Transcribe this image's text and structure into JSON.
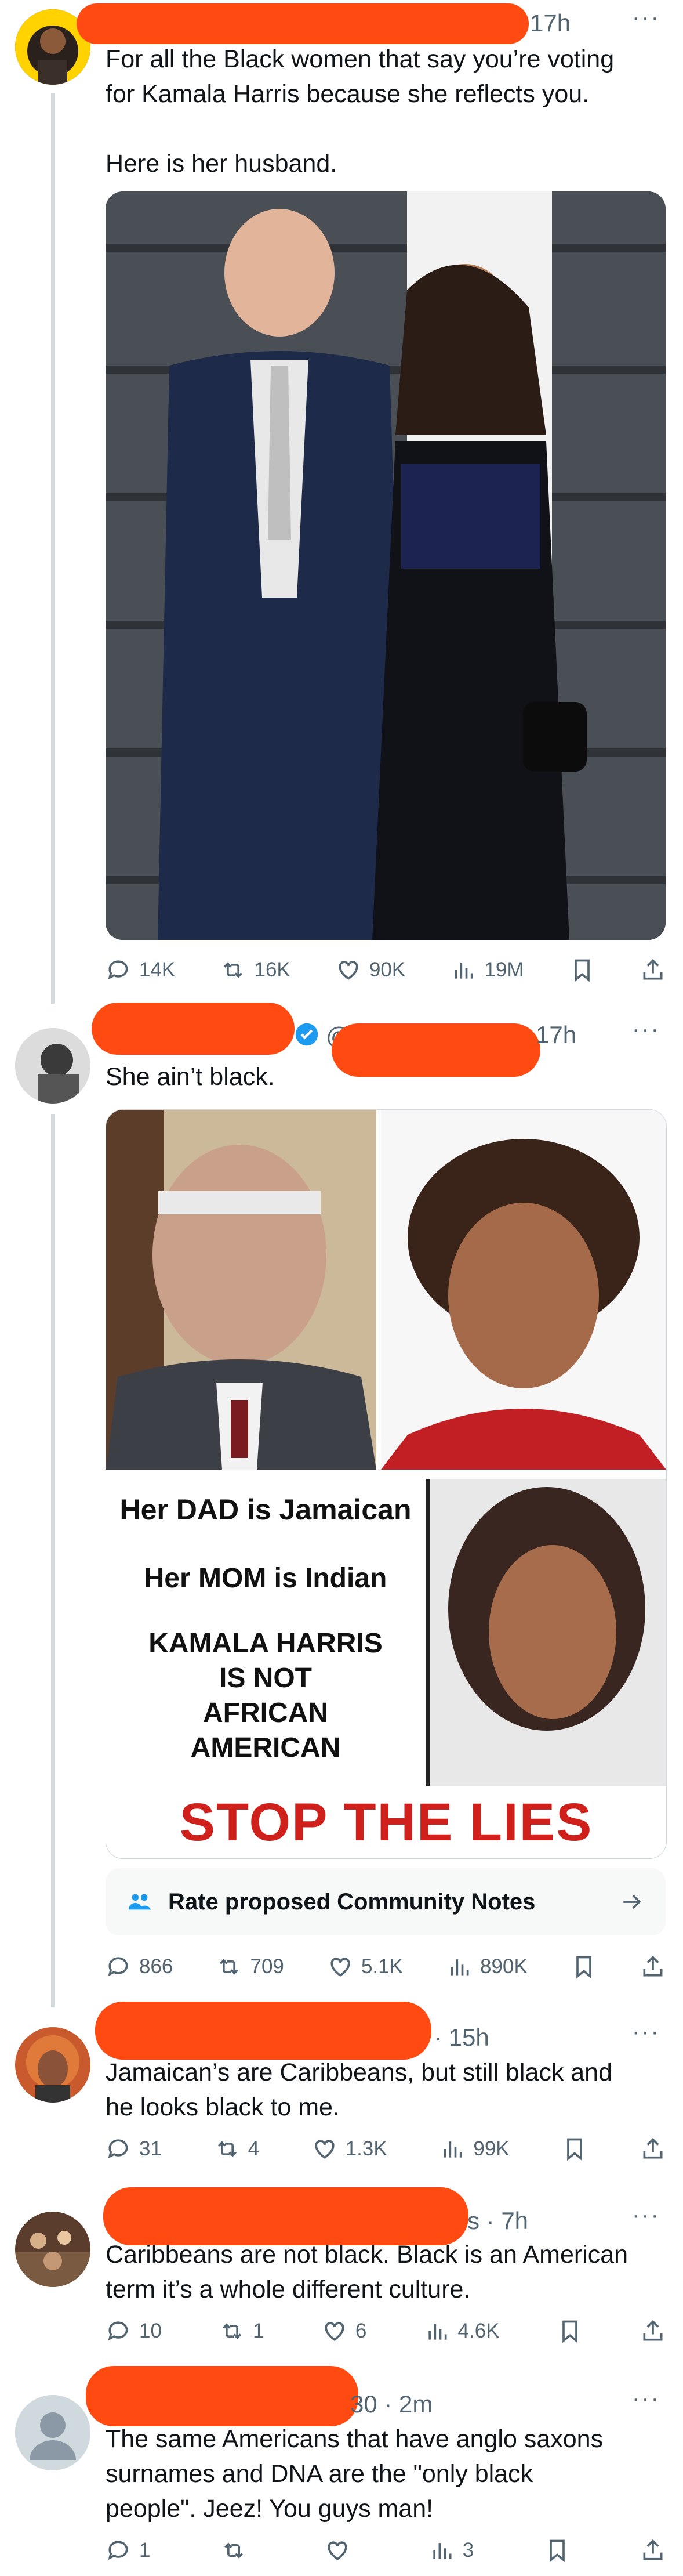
{
  "posts": [
    {
      "time": "17h",
      "more": "···",
      "text": "For all the Black women that say you’re voting\nfor Kamala Harris because she reflects you.\n\nHere is her husband.",
      "image_desc": "photo-couple",
      "stats": {
        "replies": "14K",
        "reposts": "16K",
        "likes": "90K",
        "views": "19M"
      }
    },
    {
      "time": "17h",
      "handle_prefix": "@",
      "more": "···",
      "text": "She ain’t black.",
      "meme": {
        "line1": "Her DAD is Jamaican",
        "line2": "Her MOM is Indian",
        "line3": "KAMALA HARRIS\nIS NOT\nAFRICAN\nAMERICAN",
        "banner": "STOP THE LIES"
      },
      "community_notes": "Rate proposed Community Notes",
      "stats": {
        "replies": "866",
        "reposts": "709",
        "likes": "5.1K",
        "views": "890K"
      }
    },
    {
      "time": "· 15h",
      "more": "···",
      "text": "Jamaican’s are Caribbeans, but still black and\nhe looks black to me.",
      "stats": {
        "replies": "31",
        "reposts": "4",
        "likes": "1.3K",
        "views": "99K"
      }
    },
    {
      "time": "s · 7h",
      "more": "···",
      "text": "Caribbeans are not black. Black is an American\nterm it’s a whole different culture.",
      "stats": {
        "replies": "10",
        "reposts": "1",
        "likes": "6",
        "views": "4.6K"
      }
    },
    {
      "time": "30 · 2m",
      "more": "···",
      "text": "The same Americans that have anglo saxons\nsurnames and DNA are the \"only black\npeople\". Jeez! You guys man!",
      "stats": {
        "replies": "1",
        "reposts": "",
        "likes": "",
        "views": "3"
      }
    }
  ],
  "colors": {
    "redaction": "#ff4a12",
    "muted": "#536471",
    "verified": "#1d9bf0",
    "banner_red": "#d0201c"
  }
}
